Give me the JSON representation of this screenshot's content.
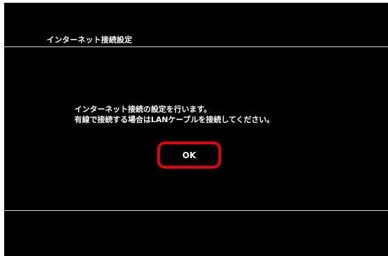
{
  "header": {
    "title": "インターネット接続設定"
  },
  "dialog": {
    "message_line1": "インターネット接続の設定を行います。",
    "message_line2": "有線で接続する場合はLANケーブルを接続してください。",
    "ok_label": "OK"
  },
  "colors": {
    "background": "#000000",
    "text": "#ffffff",
    "highlight": "#e4000f"
  }
}
